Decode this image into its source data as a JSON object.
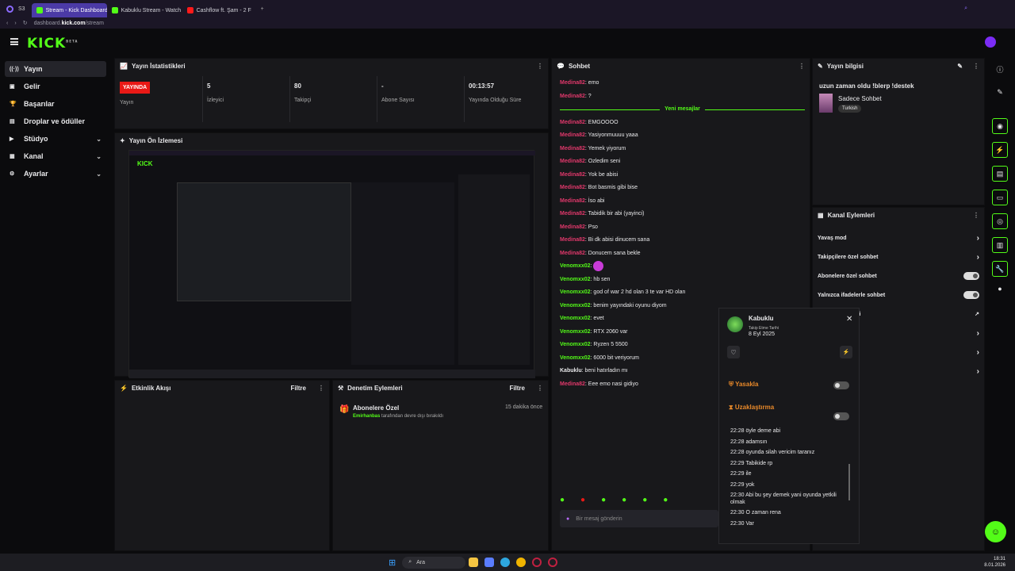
{
  "browser": {
    "tabs": [
      {
        "label": "Stream - Kick Dashboard",
        "fav": "#53fc18"
      },
      {
        "label": "Kabuklu Stream - Watch L",
        "fav": "#53fc18"
      },
      {
        "label": "Cashflow ft. Şam - 2 F",
        "fav": "#ff1a1a"
      }
    ],
    "url_prefix": "dashboard.",
    "url_domain": "kick.com",
    "url_path": "/stream"
  },
  "app": {
    "logo": "KICK",
    "logo_beta": "BETA"
  },
  "sidebar": {
    "items": [
      {
        "label": "Yayın",
        "icon": "broadcast-icon",
        "active": true
      },
      {
        "label": "Gelir",
        "icon": "money-icon"
      },
      {
        "label": "Başarılar",
        "icon": "trophy-icon"
      },
      {
        "label": "Droplar ve ödüller",
        "icon": "gift-icon"
      },
      {
        "label": "Stüdyo",
        "icon": "video-icon",
        "chevron": "⌄"
      },
      {
        "label": "Kanal",
        "icon": "layout-icon",
        "chevron": "⌄"
      },
      {
        "label": "Ayarlar",
        "icon": "gear-icon",
        "chevron": "⌄"
      }
    ]
  },
  "stats": {
    "title": "Yayın İstatistikleri",
    "live_badge": "YAYINDA",
    "live_label": "Yayın",
    "items": [
      {
        "value": "5",
        "label": "İzleyici"
      },
      {
        "value": "80",
        "label": "Takipçi"
      },
      {
        "value": "-",
        "label": "Abone Sayısı"
      },
      {
        "value": "00:13:57",
        "label": "Yayında Olduğu Süre"
      }
    ]
  },
  "preview": {
    "title": "Yayın Ön İzlemesi"
  },
  "events": {
    "title": "Etkinlik Akışı",
    "filter": "Filtre"
  },
  "moderation": {
    "title": "Denetim Eylemleri",
    "filter": "Filtre",
    "item_title": "Abonelere Özel",
    "item_time": "15 dakika önce",
    "item_user": "Emirhanbas",
    "item_text": " tarafından devre dışı bırakıldı"
  },
  "chat": {
    "title": "Sohbet",
    "new_messages": "Yeni mesajlar",
    "input_placeholder": "Bir mesaj gönderin",
    "messages": [
      {
        "user": "Medina82",
        "text": ": emo",
        "c": "u1"
      },
      {
        "user": "Medina82",
        "text": ": ?",
        "c": "u1"
      },
      {
        "divider": true
      },
      {
        "user": "Medina82",
        "text": ": EMGOOOO",
        "c": "u1"
      },
      {
        "user": "Medina82",
        "text": ": Yasiyonmuuuu yaaa",
        "c": "u1"
      },
      {
        "user": "Medina82",
        "text": ": Yemek yiyorum",
        "c": "u1"
      },
      {
        "user": "Medina82",
        "text": ": Ozledim seni",
        "c": "u1"
      },
      {
        "user": "Medina82",
        "text": ": Yok be abisi",
        "c": "u1"
      },
      {
        "user": "Medina82",
        "text": ": Bot basmis gibi bise",
        "c": "u1"
      },
      {
        "user": "Medina82",
        "text": ": İso abi",
        "c": "u1"
      },
      {
        "user": "Medina82",
        "text": ": Tabidik bir abi (yayinci)",
        "c": "u1"
      },
      {
        "user": "Medina82",
        "text": ": Pso",
        "c": "u1"
      },
      {
        "user": "Medina82",
        "text": ": Bi dk abisi dinucem sana",
        "c": "u1"
      },
      {
        "user": "Medina82",
        "text": ": Donucem sana bekle",
        "c": "u1"
      },
      {
        "user": "Venomxx02",
        "text": ": ",
        "c": "u2",
        "emote": true
      },
      {
        "user": "Venomxx02",
        "text": ": hb sen",
        "c": "u2"
      },
      {
        "user": "Venomxx02",
        "text": ": god of war 2 hd olan 3 te var HD olan",
        "c": "u2"
      },
      {
        "user": "Venomxx02",
        "text": ": benim yayındaki oyunu diyom",
        "c": "u2"
      },
      {
        "user": "Venomxx02",
        "text": ": evet",
        "c": "u2"
      },
      {
        "user": "Venomxx02",
        "text": ": RTX 2060 var",
        "c": "u2"
      },
      {
        "user": "Venomxx02",
        "text": ": Ryzen 5 5500",
        "c": "u2"
      },
      {
        "user": "Venomxx02",
        "text": ": 6000 bit veriyorum",
        "c": "u2"
      },
      {
        "user": "Kabuklu",
        "text": ": beni hatırladın mı",
        "c": "u3"
      },
      {
        "user": "Medina82",
        "text": ": Eee emo nasi gidiyo",
        "c": "u1"
      }
    ]
  },
  "stream_info": {
    "title": "Yayın bilgisi",
    "stream_title": "uzun zaman oldu !blerp !destek",
    "category": "Sadece Sohbet",
    "language": "Turkish"
  },
  "channel_actions": {
    "title": "Kanal Eylemleri",
    "items": [
      {
        "label": "Yavaş mod",
        "kind": "chevron"
      },
      {
        "label": "Takipçilere özel sohbet",
        "kind": "chevron"
      },
      {
        "label": "Abonelere özel sohbet",
        "kind": "toggle-on"
      },
      {
        "label": "Yalnızca ifadelerle sohbet",
        "kind": "toggle-off"
      },
      {
        "label": "sohbet Denetimi",
        "kind": "external"
      },
      {
        "label": "aması",
        "kind": "chevron"
      },
      {
        "label": "emeler",
        "kind": "chevron"
      },
      {
        "label": "in",
        "kind": "chevron"
      }
    ]
  },
  "user_popup": {
    "name": "Kabuklu",
    "follow_label": "Takip Etme Tarihi",
    "follow_date": "8 Eyl 2025",
    "ban_label": "Yasakla",
    "timeout_label": "Uzaklaştırma",
    "history": [
      "22:28 öyle deme abi",
      "22:28 adamsın",
      "22:28 oyunda silah vericim taranız",
      "22:29 Tabikide rp",
      "22:29 ile",
      "22:29 yok",
      "22:30 Abi bu şey demek yani oyunda yetkili olmak",
      "22:30 O zaman rena",
      "22:30 Var"
    ]
  },
  "taskbar": {
    "search": "Ara",
    "time": "18:31",
    "date": "8.01.2026"
  },
  "colors": {
    "accent": "#53fc18",
    "live": "#e91916",
    "user_red": "#e0386b"
  }
}
